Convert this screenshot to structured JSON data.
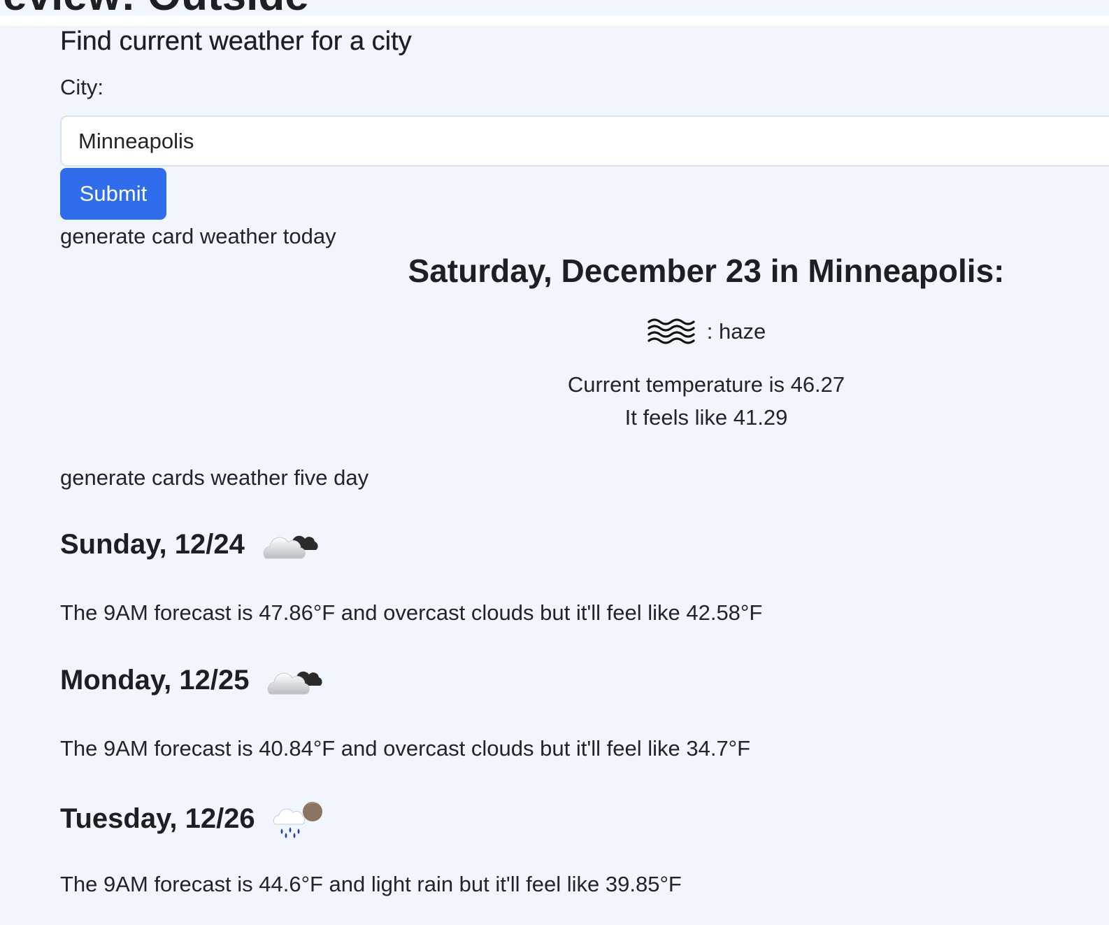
{
  "page": {
    "partial_title": "review: Outside"
  },
  "search": {
    "heading": "Find current weather for a city",
    "city_label": "City:",
    "city_value": "Minneapolis",
    "submit_label": "Submit"
  },
  "today": {
    "section_label": "generate card weather today",
    "title": "Saturday, December 23 in Minneapolis:",
    "condition_icon": "haze-icon",
    "condition_text": ": haze",
    "current_temp_text": "Current temperature is 46.27",
    "feels_like_text": "It feels like 41.29"
  },
  "five_day": {
    "section_label": "generate cards weather five day",
    "days": [
      {
        "day": "Sunday, 12/24",
        "icon": "overcast-clouds-icon",
        "forecast": "The 9AM forecast is 47.86°F and overcast clouds but it'll feel like 42.58°F"
      },
      {
        "day": "Monday, 12/25",
        "icon": "overcast-clouds-icon",
        "forecast": "The 9AM forecast is 40.84°F and overcast clouds but it'll feel like 34.7°F"
      },
      {
        "day": "Tuesday, 12/26",
        "icon": "light-rain-icon",
        "forecast": "The 9AM forecast is 44.6°F and light rain but it'll feel like 39.85°F"
      }
    ]
  }
}
